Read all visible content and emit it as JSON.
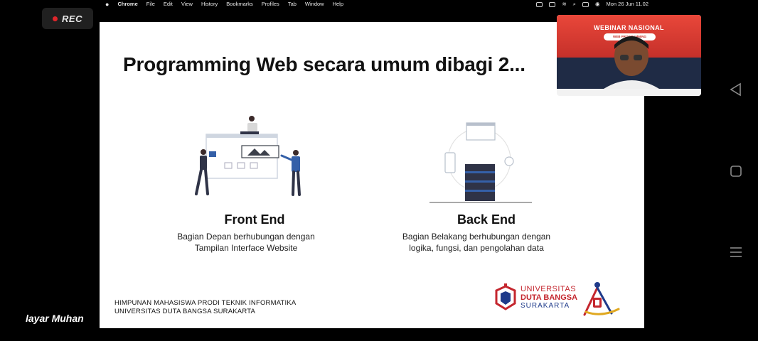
{
  "menubar": {
    "apple": "",
    "app": "Chrome",
    "items": [
      "File",
      "Edit",
      "View",
      "History",
      "Bookmarks",
      "Profiles",
      "Tab",
      "Window",
      "Help"
    ],
    "clock": "Mon 26 Jun  11.02"
  },
  "recording": {
    "label": "REC",
    "color": "#e0262b"
  },
  "slide": {
    "title": "Programming Web secara umum dibagi 2...",
    "front_end": {
      "title": "Front End",
      "desc_line1": "Bagian Depan berhubungan dengan",
      "desc_line2": "Tampilan Interface Website"
    },
    "back_end": {
      "title": "Back End",
      "desc_line1": "Bagian Belakang berhubungan dengan",
      "desc_line2": "logika, fungsi, dan pengolahan data"
    },
    "footer_line1": "HIMPUNAN MAHASISWA PRODI TEKNIK INFORMATIKA",
    "footer_line2": "UNIVERSITAS DUTA BANGSA SURAKARTA",
    "logo": {
      "line1": "UNIVERSITAS",
      "line2": "DUTA BANGSA",
      "line3": "SURAKARTA"
    }
  },
  "webcam": {
    "banner_title": "WEBINAR NASIONAL",
    "pill_text": "WEB PROGRAMMING"
  },
  "caption": "layar Muhan",
  "colors": {
    "accent_red": "#c4262e",
    "navy": "#1e3a8a",
    "slide_bg": "#ffffff"
  }
}
